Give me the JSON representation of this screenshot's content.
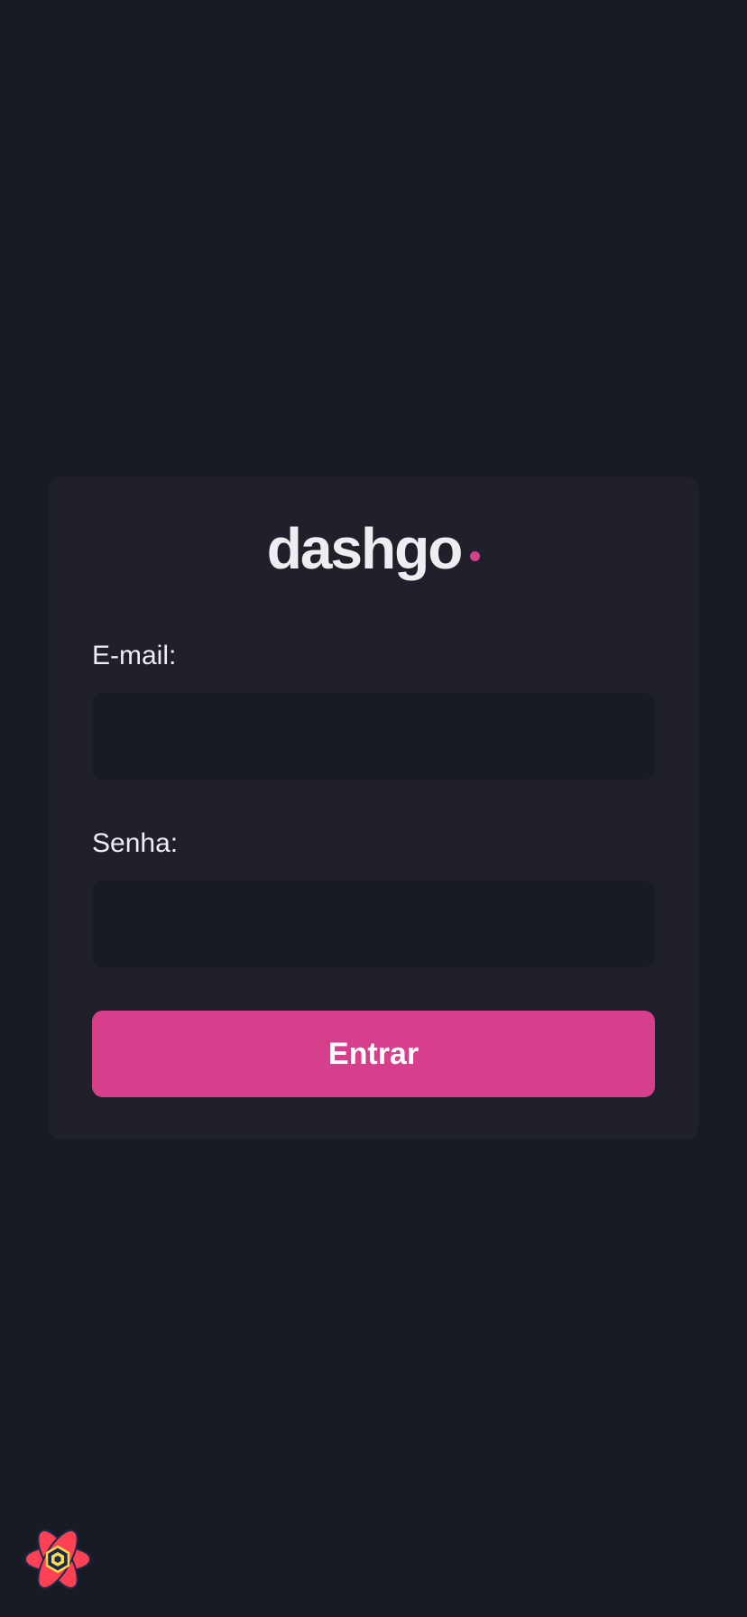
{
  "brand": {
    "name": "dashgo",
    "dot": ".",
    "accent_color": "#d53f8c"
  },
  "form": {
    "email_label": "E-mail:",
    "email_value": "",
    "password_label": "Senha:",
    "password_value": "",
    "submit_label": "Entrar"
  },
  "devtools": {
    "icon": "react-query-devtools-icon"
  },
  "colors": {
    "background": "#181b23",
    "card": "#1f2029",
    "input": "#181b23",
    "text": "#eeeef2"
  }
}
